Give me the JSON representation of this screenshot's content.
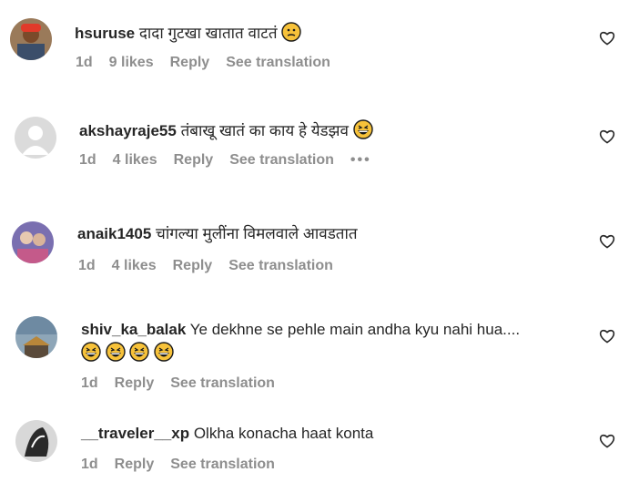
{
  "comments": [
    {
      "username": "hsuruse",
      "text": "दादा गुटखा खातात वाटतं",
      "emoji": [
        "thinking-face"
      ],
      "time": "1d",
      "likes": "9 likes",
      "reply": "Reply",
      "translate": "See translation",
      "more": ""
    },
    {
      "username": "akshayraje55",
      "text": "तंबाखू खातं का काय हे येडझव",
      "emoji": [
        "grinning-squinting-face"
      ],
      "time": "1d",
      "likes": "4 likes",
      "reply": "Reply",
      "translate": "See translation",
      "more": "•••"
    },
    {
      "username": "anaik1405",
      "text": "चांगल्या मुलींना विमलवाले आवडतात",
      "emoji": [],
      "time": "1d",
      "likes": "4 likes",
      "reply": "Reply",
      "translate": "See translation",
      "more": ""
    },
    {
      "username": "shiv_ka_balak",
      "text": "Ye dekhne se pehle main andha kyu nahi hua....",
      "emoji": [
        "grinning-squinting-face",
        "grinning-squinting-face",
        "grinning-squinting-face",
        "grinning-squinting-face"
      ],
      "time": "1d",
      "likes": "",
      "reply": "Reply",
      "translate": "See translation",
      "more": ""
    },
    {
      "username": "__traveler__xp",
      "text": "Olkha konacha haat konta",
      "emoji": [],
      "time": "1d",
      "likes": "",
      "reply": "Reply",
      "translate": "See translation",
      "more": ""
    }
  ],
  "colors": {
    "primary_text": "#262626",
    "secondary_text": "#8e8e8e",
    "emoji": "#f7c23a"
  },
  "icons": {
    "like": "heart-outline-icon"
  }
}
